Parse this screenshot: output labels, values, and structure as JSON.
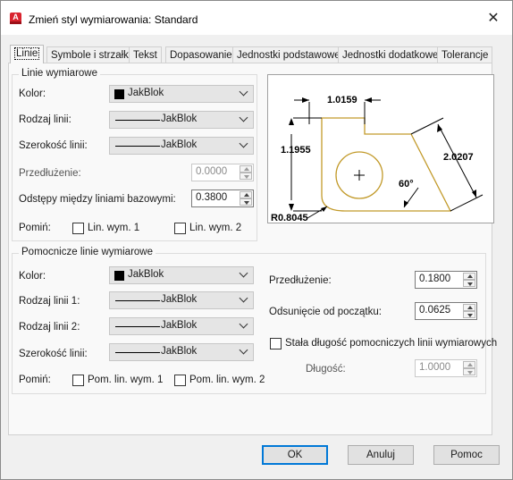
{
  "window": {
    "title": "Zmień styl wymiarowania: Standard"
  },
  "tabs": [
    {
      "label": "Linie",
      "active": true
    },
    {
      "label": "Symbole i strzałki"
    },
    {
      "label": "Tekst"
    },
    {
      "label": "Dopasowanie"
    },
    {
      "label": "Jednostki podstawowe"
    },
    {
      "label": "Jednostki dodatkowe"
    },
    {
      "label": "Tolerancje"
    }
  ],
  "dim_lines": {
    "legend": "Linie wymiarowe",
    "color_label": "Kolor:",
    "color_value": "JakBlok",
    "linetype_label": "Rodzaj linii:",
    "linetype_value": "JakBlok",
    "lineweight_label": "Szerokość linii:",
    "lineweight_value": "JakBlok",
    "extend_label": "Przedłużenie:",
    "extend_value": "0.0000",
    "baseline_label": "Odstępy między liniami bazowymi:",
    "baseline_value": "0.3800",
    "suppress_label": "Pomiń:",
    "suppress1": "Lin. wym. 1",
    "suppress2": "Lin. wym. 2"
  },
  "ext_lines": {
    "legend": "Pomocnicze linie wymiarowe",
    "color_label": "Kolor:",
    "color_value": "JakBlok",
    "linetype1_label": "Rodzaj linii 1:",
    "linetype1_value": "JakBlok",
    "linetype2_label": "Rodzaj linii 2:",
    "linetype2_value": "JakBlok",
    "lineweight_label": "Szerokość linii:",
    "lineweight_value": "JakBlok",
    "suppress_label": "Pomiń:",
    "suppress1": "Pom. lin. wym. 1",
    "suppress2": "Pom. lin. wym. 2",
    "extend_label": "Przedłużenie:",
    "extend_value": "0.1800",
    "offset_label": "Odsunięcie od początku:",
    "offset_value": "0.0625",
    "fixed_label": "Stała długość pomocniczych linii wymiarowych",
    "length_label": "Długość:",
    "length_value": "1.0000"
  },
  "preview": {
    "dim_top": "1.0159",
    "dim_left": "1.1955",
    "dim_diag": "2.0207",
    "angle": "60°",
    "radius": "R0.8045"
  },
  "buttons": {
    "ok": "OK",
    "cancel": "Anuluj",
    "help": "Pomoc"
  },
  "colors": {
    "accent": "#0078d7",
    "shape": "#c29a2a",
    "app_icon": "#d9232e"
  }
}
